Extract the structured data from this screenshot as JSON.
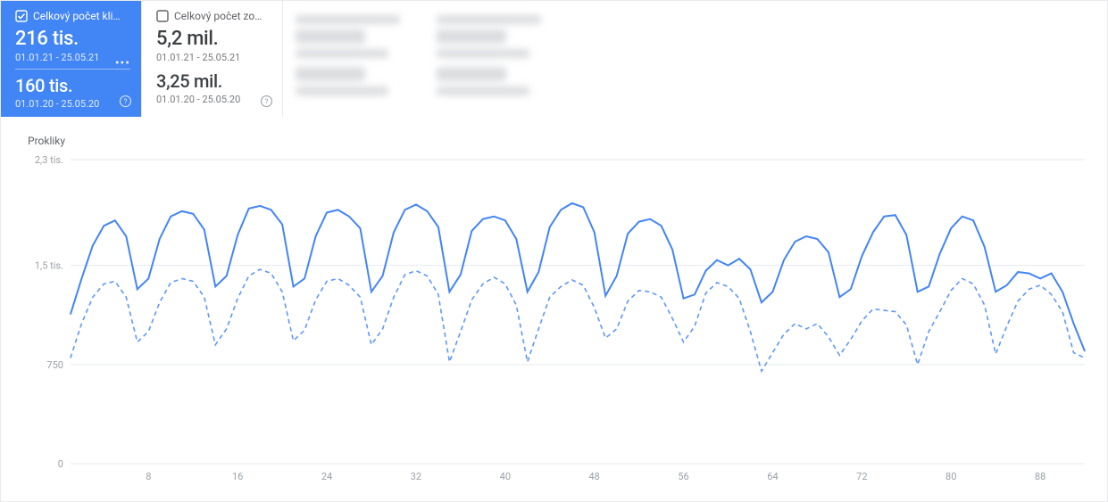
{
  "cards": {
    "clicks": {
      "title": "Celkový počet kli…",
      "val_current": "216 tis.",
      "range_current": "01.01.21 - 25.05.21",
      "val_prev": "160 tis.",
      "range_prev": "01.01.20 - 25.05.20"
    },
    "impressions": {
      "title": "Celkový počet zo…",
      "val_current": "5,2 mil.",
      "range_current": "01.01.21 - 25.05.21",
      "val_prev": "3,25 mil.",
      "range_prev": "01.01.20 - 25.05.20"
    }
  },
  "y_axis_label": "Prokliky",
  "chart_data": {
    "type": "line",
    "ylabel": "Prokliky",
    "yticks": [
      0,
      750,
      1500,
      2300
    ],
    "ytick_labels": [
      "0",
      "750",
      "1,5 tis.",
      "2,3 tis."
    ],
    "xticks": [
      8,
      16,
      24,
      32,
      40,
      48,
      56,
      64,
      72,
      80,
      88
    ],
    "xlim": [
      1,
      92
    ],
    "ylim": [
      0,
      2300
    ],
    "series": [
      {
        "name": "01.01.21 - 25.05.21",
        "style": "solid",
        "values": [
          1130,
          1400,
          1650,
          1800,
          1840,
          1720,
          1320,
          1400,
          1700,
          1870,
          1910,
          1890,
          1770,
          1340,
          1420,
          1730,
          1930,
          1950,
          1920,
          1810,
          1340,
          1400,
          1720,
          1900,
          1920,
          1870,
          1780,
          1300,
          1420,
          1750,
          1920,
          1960,
          1910,
          1790,
          1300,
          1430,
          1760,
          1850,
          1870,
          1840,
          1700,
          1300,
          1450,
          1790,
          1920,
          1970,
          1940,
          1750,
          1270,
          1420,
          1740,
          1830,
          1850,
          1800,
          1620,
          1250,
          1280,
          1460,
          1540,
          1500,
          1550,
          1470,
          1220,
          1300,
          1540,
          1680,
          1720,
          1700,
          1600,
          1260,
          1320,
          1570,
          1750,
          1870,
          1880,
          1730,
          1300,
          1340,
          1590,
          1780,
          1870,
          1840,
          1640,
          1300,
          1350,
          1450,
          1440,
          1400,
          1440,
          1300,
          1060,
          850
        ]
      },
      {
        "name": "01.01.20 - 25.05.20",
        "style": "dashed",
        "values": [
          800,
          1060,
          1260,
          1360,
          1380,
          1260,
          920,
          1000,
          1220,
          1370,
          1400,
          1380,
          1260,
          900,
          1020,
          1250,
          1420,
          1470,
          1440,
          1300,
          930,
          1010,
          1240,
          1380,
          1400,
          1350,
          1260,
          900,
          1020,
          1260,
          1430,
          1460,
          1420,
          1280,
          770,
          1000,
          1240,
          1360,
          1410,
          1360,
          1200,
          770,
          1020,
          1260,
          1340,
          1390,
          1350,
          1180,
          950,
          1020,
          1230,
          1310,
          1300,
          1260,
          1100,
          920,
          1040,
          1290,
          1370,
          1340,
          1250,
          1000,
          700,
          840,
          980,
          1060,
          1020,
          1060,
          960,
          820,
          940,
          1080,
          1170,
          1160,
          1150,
          1050,
          750,
          1000,
          1150,
          1310,
          1400,
          1360,
          1200,
          830,
          1040,
          1230,
          1320,
          1350,
          1280,
          1150,
          840,
          800
        ]
      }
    ]
  }
}
